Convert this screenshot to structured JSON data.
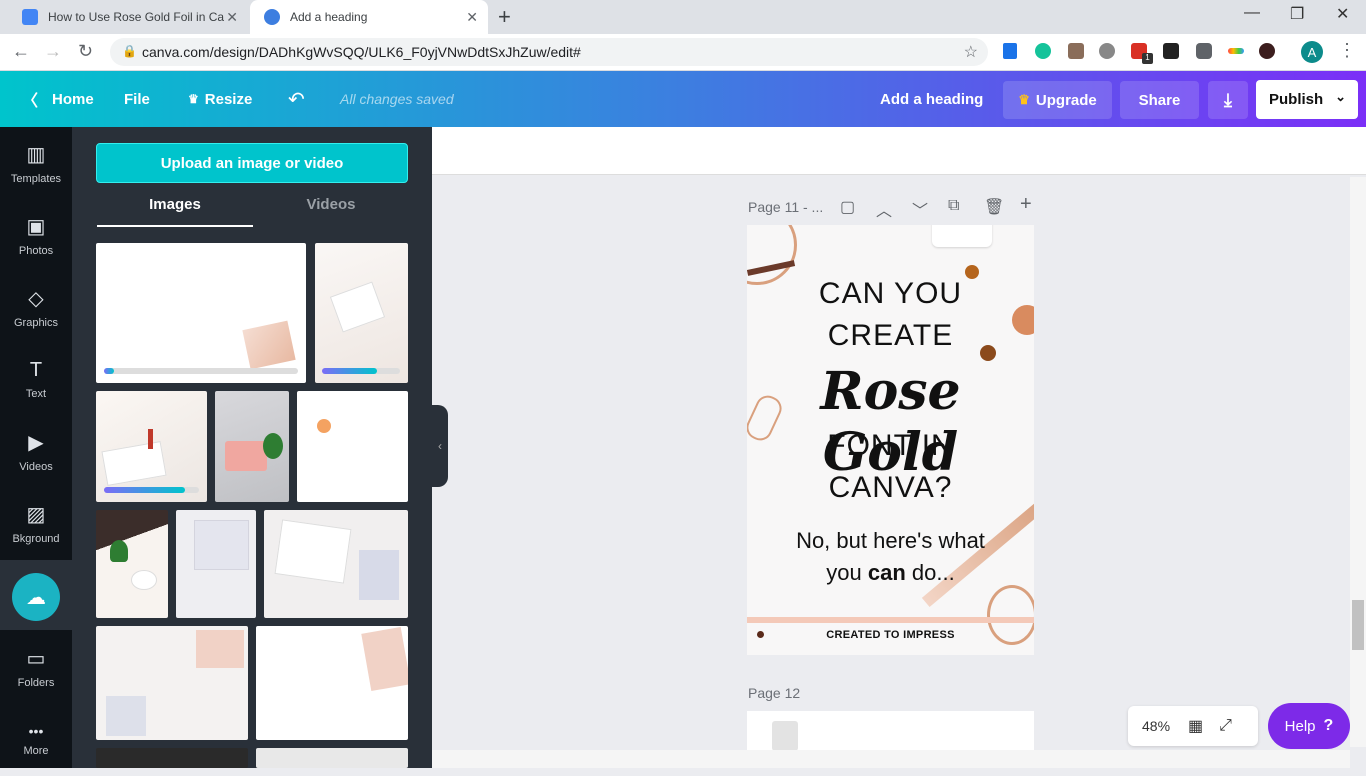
{
  "browser": {
    "tabs": [
      {
        "title": "How to Use Rose Gold Foil in Can",
        "favicon_color": "#4285f4"
      },
      {
        "title": "Add a heading",
        "favicon_color": "#3d7ee0"
      }
    ],
    "url": "canva.com/design/DADhKgWvSQQ/ULK6_F0yjVNwDdtSxJhZuw/edit#",
    "profile_initial": "A",
    "ext_badge": "1"
  },
  "header": {
    "home": "Home",
    "file": "File",
    "resize": "Resize",
    "saved_status": "All changes saved",
    "design_title": "Add a heading",
    "upgrade": "Upgrade",
    "share": "Share",
    "publish": "Publish"
  },
  "rail": [
    {
      "label": "Templates",
      "icon": "templates-icon",
      "glyph": "▥"
    },
    {
      "label": "Photos",
      "icon": "photos-icon",
      "glyph": "▣"
    },
    {
      "label": "Graphics",
      "icon": "graphics-icon",
      "glyph": "◇"
    },
    {
      "label": "Text",
      "icon": "text-icon",
      "glyph": "T"
    },
    {
      "label": "Videos",
      "icon": "videos-icon",
      "glyph": "▶"
    },
    {
      "label": "Bkground",
      "icon": "background-icon",
      "glyph": "▨"
    },
    {
      "label": "Folders",
      "icon": "folders-icon",
      "glyph": "▭"
    },
    {
      "label": "More",
      "icon": "more-icon",
      "glyph": "•••"
    }
  ],
  "panel": {
    "upload_button": "Upload an image or video",
    "tabs": [
      "Images",
      "Videos"
    ],
    "upload_progress": [
      0.05,
      0.7,
      0.85
    ]
  },
  "canvas": {
    "page11_label": "Page 11 - ...",
    "page12_label": "Page 12",
    "design": {
      "line1": "CAN YOU",
      "line2": "CREATE",
      "script": "Rose Gold",
      "line3": "FONT IN",
      "line4": "CANVA?",
      "sub1": "No, but here's what",
      "sub2_pre": "you ",
      "sub2_bold": "can",
      "sub2_post": " do...",
      "footer": "CREATED TO IMPRESS"
    },
    "zoom": "48%",
    "help": "Help"
  },
  "colors": {
    "accent": "#00c4cc",
    "brand_purple": "#7d2ae8",
    "rose_gold": "#d9a07e"
  }
}
